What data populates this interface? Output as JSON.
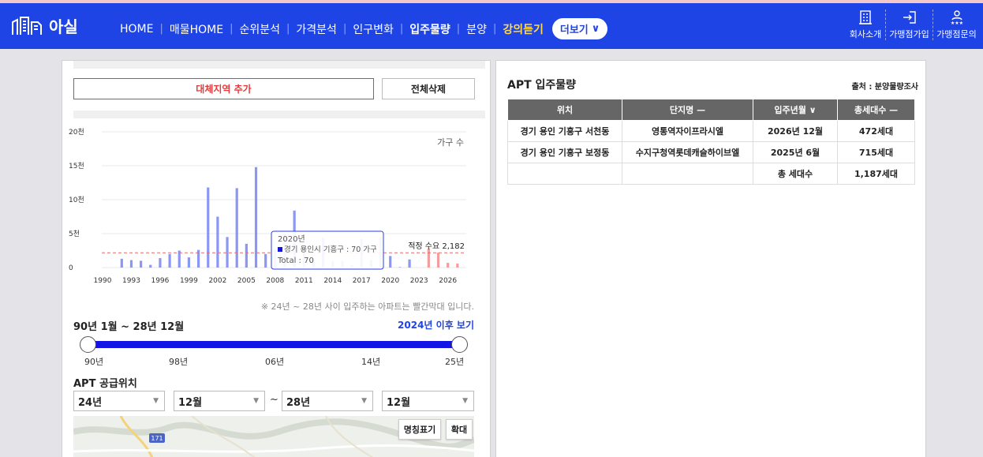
{
  "brand": {
    "logo_text": "아실"
  },
  "nav": {
    "items": [
      {
        "label": "HOME",
        "style": "normal"
      },
      {
        "label": "매물HOME",
        "style": "normal"
      },
      {
        "label": "순위분석",
        "style": "normal"
      },
      {
        "label": "가격분석",
        "style": "normal"
      },
      {
        "label": "인구변화",
        "style": "normal"
      },
      {
        "label": "입주물량",
        "style": "active"
      },
      {
        "label": "분양",
        "style": "normal"
      },
      {
        "label": "강의듣기",
        "style": "gold"
      }
    ],
    "more_label": "더보기",
    "right_links": [
      {
        "label": "회사소개",
        "icon": "building-icon"
      },
      {
        "label": "가맹점가입",
        "icon": "signin-icon"
      },
      {
        "label": "가맹점문의",
        "icon": "user-stars-icon"
      }
    ]
  },
  "left": {
    "add_region_label": "대체지역 추가",
    "delete_all_label": "전체삭제",
    "note": "※ 24년 ~ 28년 사이 입주하는 아파트는 빨간막대 입니다.",
    "range_label": "90년 1월 ~ 28년 12월",
    "after_link": "2024년 이후 보기",
    "slider_labels": [
      "90년",
      "98년",
      "06년",
      "14년",
      "25년"
    ],
    "supply_label": "APT 공급위치",
    "selects": {
      "from_year": "24년",
      "from_month": "12월",
      "tilde": "~",
      "to_year": "28년",
      "to_month": "12월"
    },
    "map_buttons": {
      "names": "명칭표기",
      "zoom": "확대"
    },
    "map_road_label": "171"
  },
  "chart_data": {
    "type": "bar",
    "unit_label": "가구 수",
    "y_ticks": [
      {
        "v": 0,
        "label": "0"
      },
      {
        "v": 5000,
        "label": "5천"
      },
      {
        "v": 10000,
        "label": "10천"
      },
      {
        "v": 15000,
        "label": "15천"
      },
      {
        "v": 20000,
        "label": "20천"
      }
    ],
    "ylim": [
      0,
      20000
    ],
    "x_tick_labels": [
      "1990",
      "1993",
      "1996",
      "1999",
      "2002",
      "2005",
      "2008",
      "2011",
      "2014",
      "2017",
      "2020",
      "2023",
      "2026"
    ],
    "years": [
      1990,
      1991,
      1992,
      1993,
      1994,
      1995,
      1996,
      1997,
      1998,
      1999,
      2000,
      2001,
      2002,
      2003,
      2004,
      2005,
      2006,
      2007,
      2008,
      2009,
      2010,
      2011,
      2012,
      2013,
      2014,
      2015,
      2016,
      2017,
      2018,
      2019,
      2020,
      2021,
      2022,
      2023,
      2024,
      2025,
      2026,
      2027,
      2028
    ],
    "values": [
      0,
      0,
      1300,
      1100,
      1000,
      400,
      1400,
      2000,
      2500,
      1500,
      2600,
      11800,
      7500,
      4500,
      11700,
      3500,
      14800,
      2000,
      2700,
      5000,
      8400,
      3200,
      1400,
      4400,
      900,
      1000,
      400,
      4200,
      1100,
      4500,
      1700,
      70,
      1200,
      0,
      2800,
      2200,
      700,
      600,
      0
    ],
    "highlight_from_year": 2024,
    "reference_line": {
      "value": 2182,
      "label": "적정 수요 2,182"
    },
    "tooltip": {
      "year": "2020년",
      "series_line": "경기 용인시 기흥구 : 70 가구",
      "total_line": "Total : 70"
    },
    "colors": {
      "normal": "#8b97f2",
      "highlight": "#f39e9e",
      "reference": "#e86a6a",
      "tooltip_border": "#2a3de0",
      "series_swatch": "#1313e6"
    }
  },
  "right": {
    "title": "APT 입주물량",
    "source": "출처 : 분양물량조사",
    "headers": [
      "위치",
      "단지명 —",
      "입주년월 ∨",
      "총세대수 —"
    ],
    "rows": [
      [
        "경기 용인 기흥구 서천동",
        "영통역자이프라시엘",
        "2026년 12월",
        "472세대"
      ],
      [
        "경기 용인 기흥구 보정동",
        "수지구청역롯데캐슬하이브엘",
        "2025년 6월",
        "715세대"
      ],
      [
        "",
        "",
        "총 세대수",
        "1,187세대"
      ]
    ]
  }
}
